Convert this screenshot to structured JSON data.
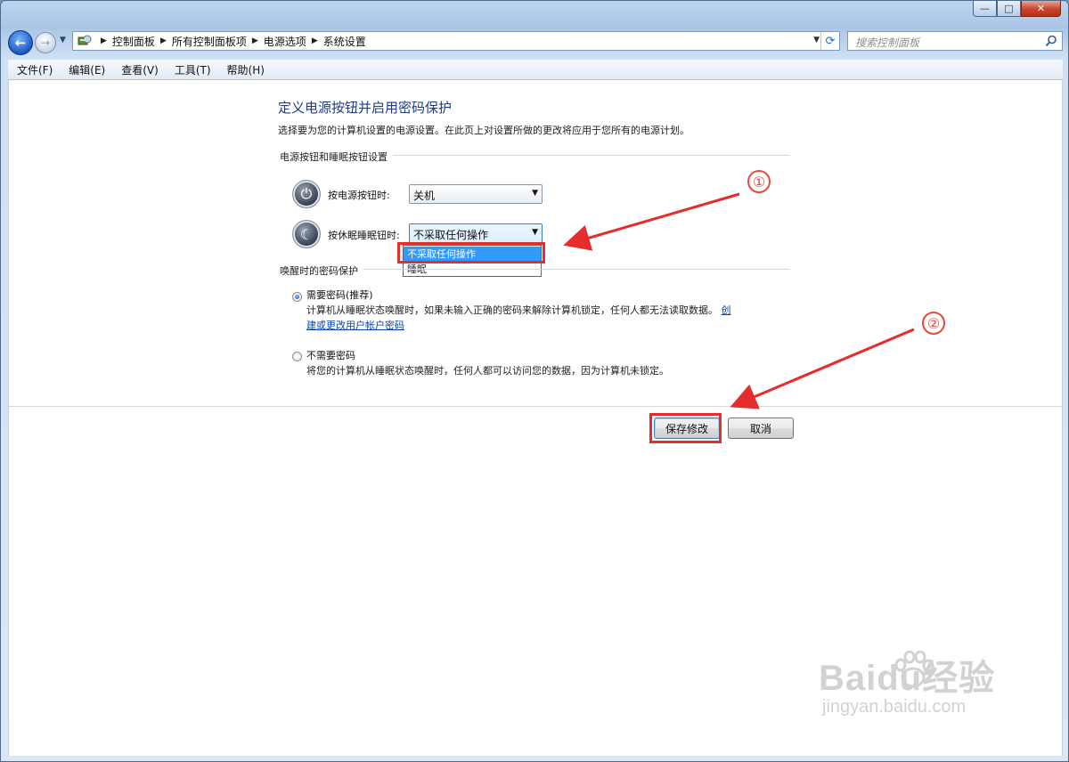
{
  "window": {
    "caption": {
      "minimize": "—",
      "maximize": "□",
      "close": "✕"
    }
  },
  "navbar": {
    "breadcrumbs": [
      "控制面板",
      "所有控制面板项",
      "电源选项",
      "系统设置"
    ],
    "search_placeholder": "搜索控制面板"
  },
  "menu": [
    "文件(F)",
    "编辑(E)",
    "查看(V)",
    "工具(T)",
    "帮助(H)"
  ],
  "page": {
    "title": "定义电源按钮并启用密码保护",
    "description": "选择要为您的计算机设置的电源设置。在此页上对设置所做的更改将应用于您所有的电源计划。",
    "section_buttons": "电源按钮和睡眠按钮设置",
    "power_button_label": "按电源按钮时:",
    "power_button_value": "关机",
    "sleep_button_label": "按休眠睡眠钮时:",
    "sleep_button_value": "不采取任何操作",
    "sleep_options": [
      "不采取任何操作",
      "睡眠"
    ],
    "section_password": "唤醒时的密码保护",
    "require_password_title": "需要密码(推荐)",
    "require_password_desc": "计算机从睡眠状态唤醒时，如果未输入正确的密码来解除计算机锁定，任何人都无法读取数据。",
    "require_password_link_a": "创",
    "require_password_link_b": "建或更改用户帐户密码",
    "no_password_title": "不需要密码",
    "no_password_desc": "将您的计算机从睡眠状态唤醒时，任何人都可以访问您的数据，因为计算机未锁定。",
    "save_button": "保存修改",
    "cancel_button": "取消"
  },
  "annotations": {
    "step1": "①",
    "step2": "②",
    "color": "#e52d2d"
  },
  "watermark": {
    "main": "Baidu经验",
    "sub": "jingyan.baidu.com"
  }
}
